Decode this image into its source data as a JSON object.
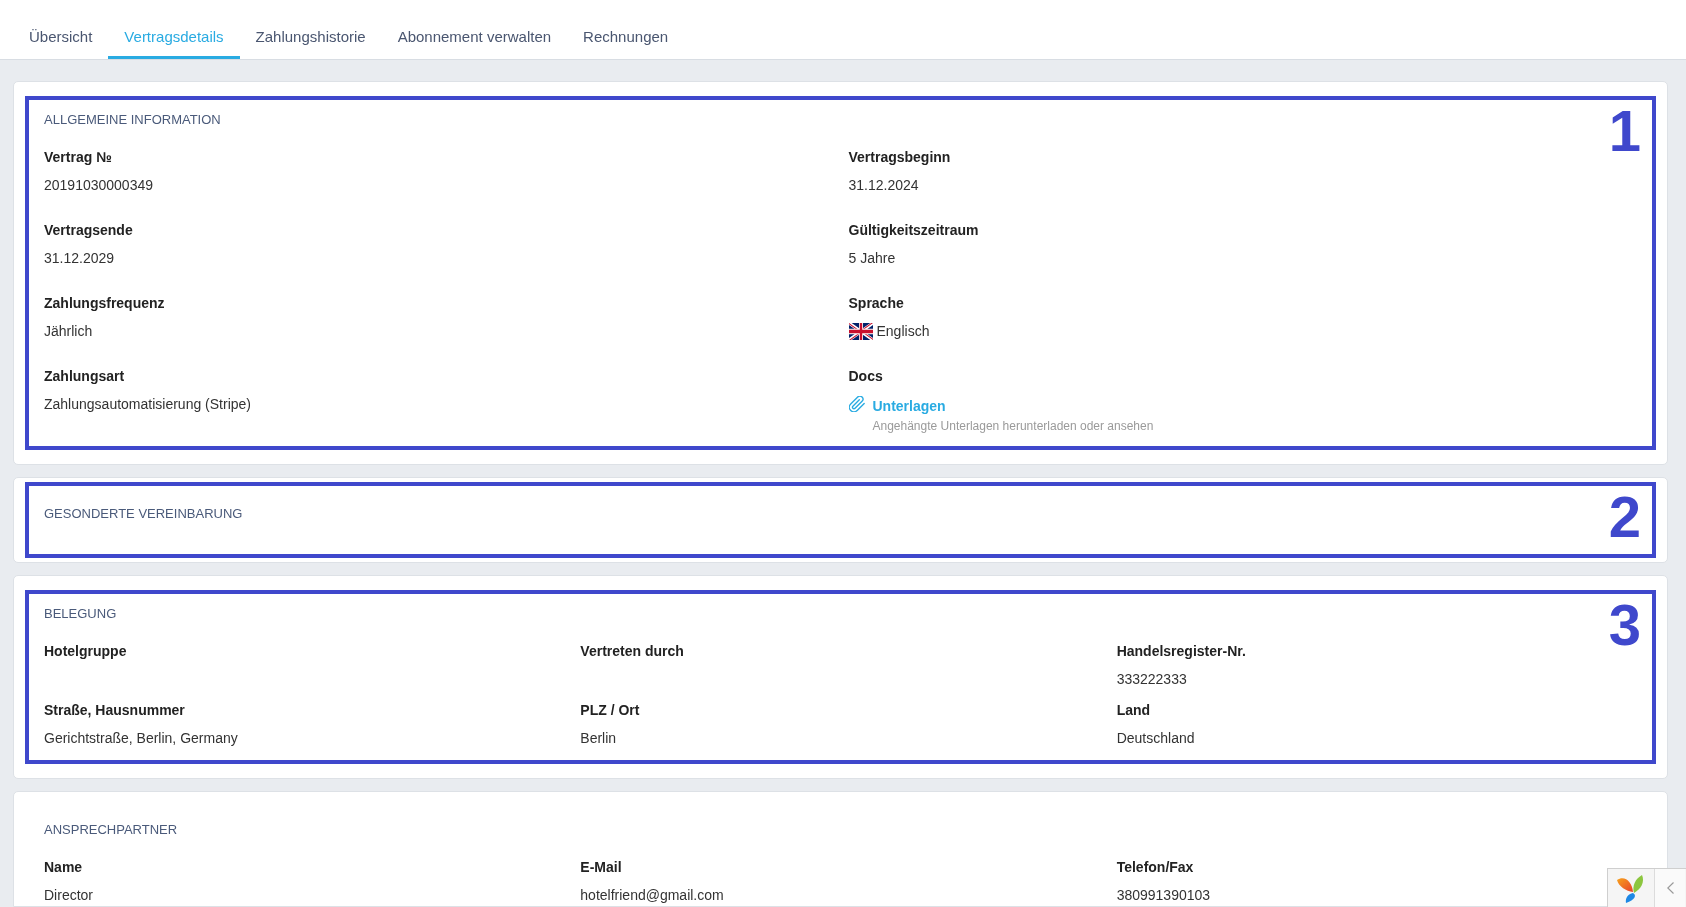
{
  "tabs": [
    {
      "label": "Übersicht",
      "selected": false
    },
    {
      "label": "Vertragsdetails",
      "selected": true
    },
    {
      "label": "Zahlungshistorie",
      "selected": false
    },
    {
      "label": "Abonnement verwalten",
      "selected": false
    },
    {
      "label": "Rechnungen",
      "selected": false
    }
  ],
  "sections": [
    {
      "title": "ALLGEMEINE INFORMATION",
      "annotation": "1",
      "rows": [
        [
          {
            "kind": "text",
            "label": "Vertrag №",
            "value": "20191030000349"
          },
          {
            "kind": "text",
            "label": "Vertragsbeginn",
            "value": "31.12.2024"
          }
        ],
        [
          {
            "kind": "text",
            "label": "Vertragsende",
            "value": "31.12.2029"
          },
          {
            "kind": "text",
            "label": "Gültigkeitszeitraum",
            "value": "5 Jahre"
          }
        ],
        [
          {
            "kind": "text",
            "label": "Zahlungsfrequenz",
            "value": "Jährlich"
          },
          {
            "kind": "language",
            "label": "Sprache",
            "value": "Englisch"
          }
        ],
        [
          {
            "kind": "text",
            "label": "Zahlungsart",
            "value": "Zahlungsautomatisierung (Stripe)"
          },
          {
            "kind": "attachment",
            "label": "Docs",
            "link": "Unterlagen",
            "hint": "Angehängte Unterlagen herunterladen oder ansehen"
          }
        ]
      ]
    },
    {
      "title": "GESONDERTE VEREINBARUNG",
      "annotation": "2"
    },
    {
      "title": "BELEGUNG",
      "annotation": "3",
      "rows": [
        [
          {
            "kind": "text",
            "label": "Hotelgruppe"
          },
          {
            "kind": "text",
            "label": "Vertreten durch"
          },
          {
            "kind": "text",
            "label": "Handelsregister-Nr.",
            "value": "333222333"
          }
        ],
        [
          {
            "kind": "text",
            "label": "Straße, Hausnummer",
            "value": "Gerichtstraße, Berlin, Germany"
          },
          {
            "kind": "text",
            "label": "PLZ / Ort",
            "value": "Berlin"
          },
          {
            "kind": "text",
            "label": "Land",
            "value": "Deutschland"
          }
        ]
      ]
    },
    {
      "title": "ANSPRECHPARTNER",
      "rows": [
        [
          {
            "kind": "text",
            "label": "Name",
            "value": "Director"
          },
          {
            "kind": "text",
            "label": "E-Mail",
            "value": "hotelfriend@gmail.com"
          },
          {
            "kind": "text",
            "label": "Telefon/Fax",
            "value": "380991390103"
          }
        ]
      ]
    }
  ]
}
